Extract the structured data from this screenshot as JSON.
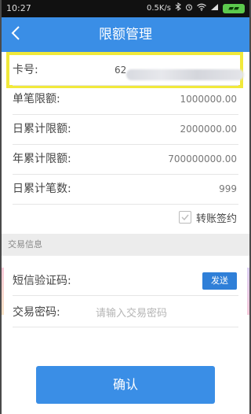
{
  "status_bar": {
    "time": "10:27",
    "network_speed": "0.5K/s"
  },
  "nav": {
    "title": "限额管理",
    "back_icon": "chevron-left-icon"
  },
  "card": {
    "label": "卡号:",
    "number_visible_prefix": "62"
  },
  "limits": [
    {
      "label": "单笔限额:",
      "value": "1000000.00"
    },
    {
      "label": "日累计限额:",
      "value": "2000000.00"
    },
    {
      "label": "年累计限额:",
      "value": "700000000.00"
    },
    {
      "label": "日累计笔数:",
      "value": "999"
    }
  ],
  "transfer_sign": {
    "label": "转账签约",
    "checked": true
  },
  "section_title": "交易信息",
  "sms": {
    "label": "短信验证码:",
    "send_label": "发送"
  },
  "password": {
    "label": "交易密码:",
    "placeholder": "请输入交易密码"
  },
  "confirm_label": "确认",
  "colors": {
    "primary": "#3a8ee6",
    "highlight": "#f1e93a"
  }
}
